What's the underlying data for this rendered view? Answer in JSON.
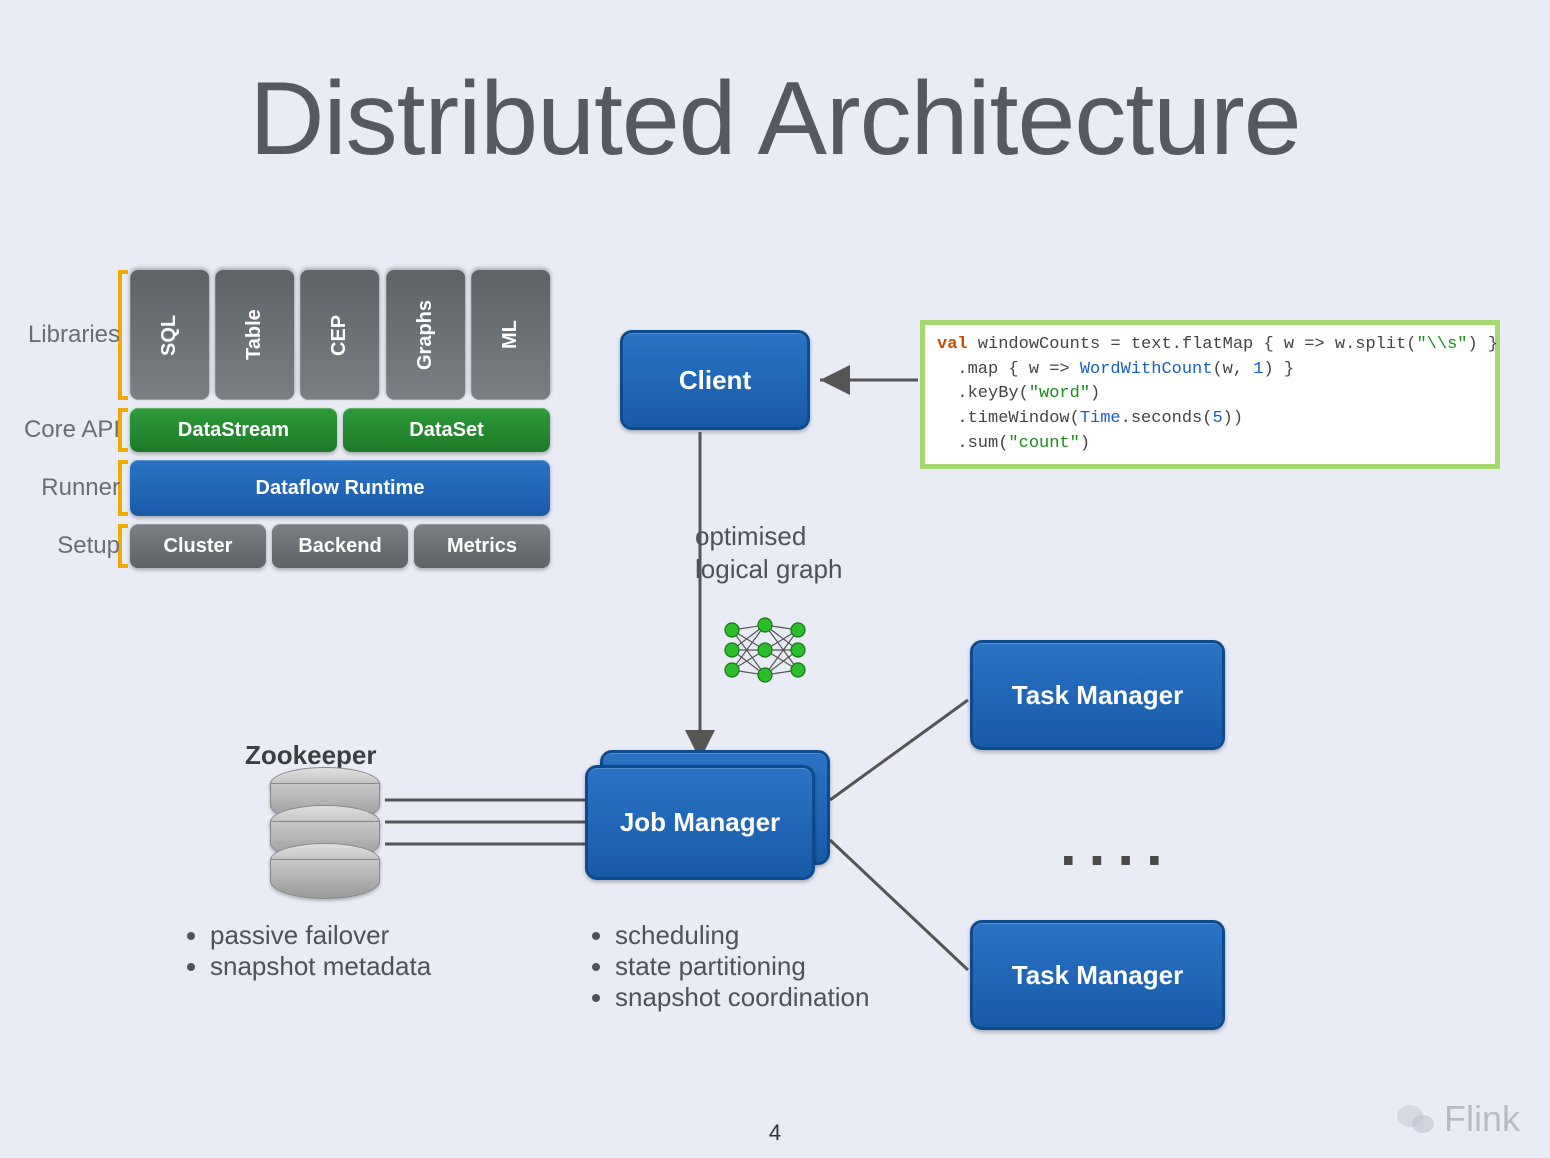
{
  "title": "Distributed Architecture",
  "page_number": "4",
  "watermark": "Flink",
  "stack": {
    "labels": {
      "libraries": "Libraries",
      "core_api": "Core API",
      "runner": "Runner",
      "setup": "Setup"
    },
    "libraries": [
      "SQL",
      "Table",
      "CEP",
      "Graphs",
      "ML"
    ],
    "core_api": [
      "DataStream",
      "DataSet"
    ],
    "runner": "Dataflow Runtime",
    "setup": [
      "Cluster",
      "Backend",
      "Metrics"
    ]
  },
  "nodes": {
    "client": "Client",
    "job_manager": "Job Manager",
    "task_manager_1": "Task Manager",
    "task_manager_2": "Task Manager",
    "ellipsis": "...."
  },
  "annotations": {
    "optimised_graph_line1": "optimised",
    "optimised_graph_line2": "logical graph",
    "zookeeper_title": "Zookeeper",
    "zookeeper_bullets": [
      "passive failover",
      "snapshot metadata"
    ],
    "jobmanager_bullets": [
      "scheduling",
      "state partitioning",
      "snapshot coordination"
    ]
  },
  "code": {
    "line1_a": "val",
    "line1_b": " windowCounts = text.flatMap { w => w.split(",
    "line1_c": "\"\\\\s\"",
    "line1_d": ") }",
    "line2_a": "  .map { w => ",
    "line2_b": "WordWithCount",
    "line2_c": "(w, ",
    "line2_d": "1",
    "line2_e": ") }",
    "line3_a": "  .keyBy(",
    "line3_b": "\"word\"",
    "line3_c": ")",
    "line4_a": "  .timeWindow(",
    "line4_b": "Time",
    "line4_c": ".seconds(",
    "line4_d": "5",
    "line4_e": "))",
    "line5_a": "  .sum(",
    "line5_b": "\"count\"",
    "line5_c": ")"
  }
}
